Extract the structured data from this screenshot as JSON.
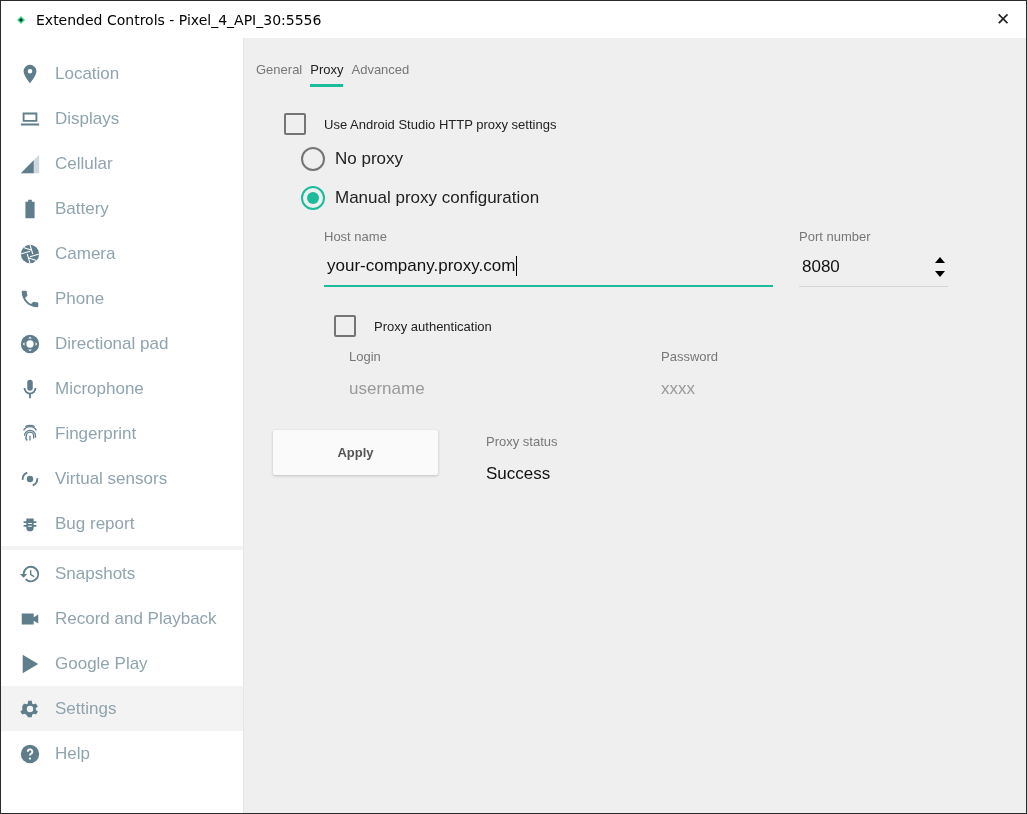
{
  "window": {
    "title": "Extended Controls - Pixel_4_API_30:5556",
    "close": "✕"
  },
  "sidebar": {
    "sections": [
      {
        "items": [
          {
            "label": "Location",
            "selected": false
          },
          {
            "label": "Displays",
            "selected": false
          },
          {
            "label": "Cellular",
            "selected": false
          },
          {
            "label": "Battery",
            "selected": false
          },
          {
            "label": "Camera",
            "selected": false
          },
          {
            "label": "Phone",
            "selected": false
          },
          {
            "label": "Directional pad",
            "selected": false
          },
          {
            "label": "Microphone",
            "selected": false
          },
          {
            "label": "Fingerprint",
            "selected": false
          },
          {
            "label": "Virtual sensors",
            "selected": false
          },
          {
            "label": "Bug report",
            "selected": false
          }
        ]
      },
      {
        "items": [
          {
            "label": "Snapshots",
            "selected": false
          },
          {
            "label": "Record and Playback",
            "selected": false
          },
          {
            "label": "Google Play",
            "selected": false
          },
          {
            "label": "Settings",
            "selected": true
          },
          {
            "label": "Help",
            "selected": false
          }
        ]
      }
    ]
  },
  "tabs": [
    {
      "label": "General",
      "selected": false
    },
    {
      "label": "Proxy",
      "selected": true
    },
    {
      "label": "Advanced",
      "selected": false
    }
  ],
  "use_studio_proxy": {
    "label": "Use Android Studio HTTP proxy settings",
    "checked": false
  },
  "proxy_mode": [
    {
      "label": "No proxy",
      "selected": false
    },
    {
      "label": "Manual proxy configuration",
      "selected": true
    }
  ],
  "host": {
    "label": "Host name",
    "value": "your-company.proxy.com",
    "focused": true
  },
  "port": {
    "label": "Port number",
    "value": "8080",
    "focused": false
  },
  "authentication": {
    "label": "Proxy authentication",
    "checked": false
  },
  "login": {
    "label": "Login",
    "placeholder": "username"
  },
  "password": {
    "label": "Password",
    "placeholder": "xxxx"
  },
  "apply_button": "Apply",
  "status": {
    "label": "Proxy status",
    "value": "Success"
  }
}
